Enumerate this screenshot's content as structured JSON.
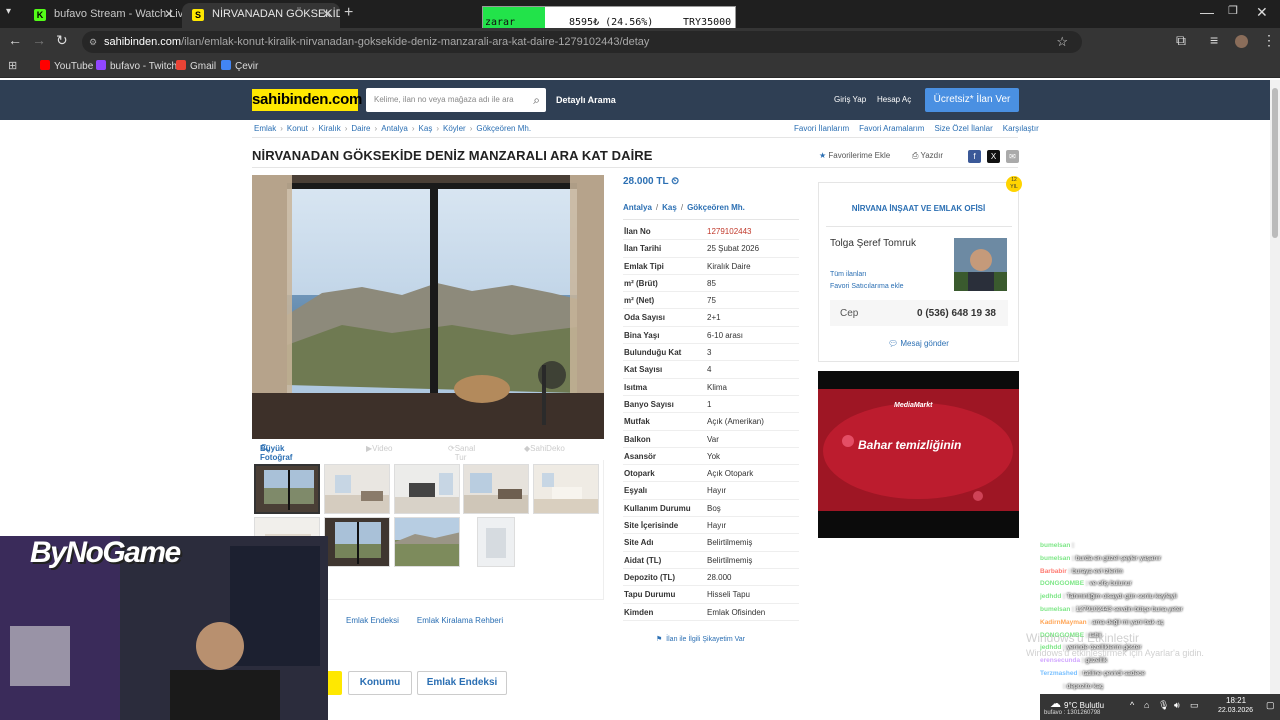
{
  "browser": {
    "tabs": [
      {
        "title": "bufavo Stream - Watch Live on",
        "active": false,
        "icon": "kick-icon",
        "color": "#53fc18"
      },
      {
        "title": "NİRVANADAN GÖKSEKİDE DEN",
        "active": true,
        "icon": "sahibinden-icon",
        "color": "#ffe800"
      }
    ],
    "url_domain": "sahibinden.com",
    "url_path": "/ilan/emlak-konut-kiralik-nirvanadan-goksekide-deniz-manzarali-ara-kat-daire-1279102443/detay",
    "bookmarks": [
      {
        "label": "YouTube",
        "color": "#ff0000"
      },
      {
        "label": "bufavo - Twitch",
        "color": "#9146ff"
      },
      {
        "label": "Gmail",
        "color": "#ea4335"
      },
      {
        "label": "Çevir",
        "color": "#4285f4"
      }
    ]
  },
  "overlay": {
    "label": "zarar",
    "value": "8595₺ (24.56%)",
    "total": "TRY35000",
    "accent": "#22e34a"
  },
  "site": {
    "logo": "sahibinden.com",
    "search_placeholder": "Kelime, ilan no veya mağaza adı ile ara",
    "detailed_search": "Detaylı Arama",
    "login": "Giriş Yap",
    "register": "Hesap Aç",
    "post_ad": "Ücretsiz* İlan Ver",
    "brand_color": "#ffe800",
    "header_color": "#2f3f54"
  },
  "breadcrumbs": [
    "Emlak",
    "Konut",
    "Kiralık",
    "Daire",
    "Antalya",
    "Kaş",
    "Köyler",
    "Gökçeören Mh."
  ],
  "right_links": [
    "Favori İlanlarım",
    "Favori Aramalarım",
    "Size Özel İlanlar",
    "Karşılaştır"
  ],
  "listing": {
    "title": "NİRVANADAN GÖKSEKİDE DENİZ MANZARALI ARA KAT DAİRE",
    "add_favorite": "Favorilerime Ekle",
    "print": "Yazdır",
    "photo_tabs": [
      "Büyük Fotoğraf",
      "Video",
      "Sanal Tur",
      "SahiDeko"
    ],
    "price": "28.000 TL",
    "location": [
      "Antalya",
      "Kaş",
      "Gökçeören Mh."
    ],
    "attributes": [
      {
        "key": "İlan No",
        "value": "1279102443"
      },
      {
        "key": "İlan Tarihi",
        "value": "25 Şubat 2026"
      },
      {
        "key": "Emlak Tipi",
        "value": "Kiralık Daire"
      },
      {
        "key": "m² (Brüt)",
        "value": "85"
      },
      {
        "key": "m² (Net)",
        "value": "75"
      },
      {
        "key": "Oda Sayısı",
        "value": "2+1"
      },
      {
        "key": "Bina Yaşı",
        "value": "6-10 arası"
      },
      {
        "key": "Bulunduğu Kat",
        "value": "3"
      },
      {
        "key": "Kat Sayısı",
        "value": "4"
      },
      {
        "key": "Isıtma",
        "value": "Klima"
      },
      {
        "key": "Banyo Sayısı",
        "value": "1"
      },
      {
        "key": "Mutfak",
        "value": "Açık (Amerikan)"
      },
      {
        "key": "Balkon",
        "value": "Var"
      },
      {
        "key": "Asansör",
        "value": "Yok"
      },
      {
        "key": "Otopark",
        "value": "Açık Otopark"
      },
      {
        "key": "Eşyalı",
        "value": "Hayır"
      },
      {
        "key": "Kullanım Durumu",
        "value": "Boş"
      },
      {
        "key": "Site İçerisinde",
        "value": "Hayır"
      },
      {
        "key": "Site Adı",
        "value": "Belirtilmemiş"
      },
      {
        "key": "Aidat (TL)",
        "value": "Belirtilmemiş"
      },
      {
        "key": "Depozito (TL)",
        "value": "28.000"
      },
      {
        "key": "Tapu Durumu",
        "value": "Hisseli Tapu"
      },
      {
        "key": "Kimden",
        "value": "Emlak Ofisinden"
      }
    ],
    "complaint": "İlan ile İlgili Şikayetim Var"
  },
  "seller": {
    "store": "NİRVANA İNŞAAT VE EMLAK OFİSİ",
    "owner": "Tolga Şeref Tomruk",
    "all_ads": "Tüm ilanları",
    "fav_seller": "Favori Satıcılarıma ekle",
    "cell_label": "Cep",
    "cell_number": "0 (536) 648 19 38",
    "message": "Mesaj gönder",
    "badge_top": "12",
    "badge_bottom": "YIL"
  },
  "ad": {
    "brand": "MediaMarkt",
    "headline": "Bahar temizliğinin"
  },
  "bottom": {
    "links": [
      "Emlak Endeksi",
      "Emlak Kiralama Rehberi"
    ],
    "tabs": [
      "Konumu",
      "Emlak Endeksi"
    ]
  },
  "stream": {
    "overlay_brand": "ByNoGame"
  },
  "chat": [
    {
      "user": "bumelsan",
      "msg": "",
      "color": "#7ee787"
    },
    {
      "user": "bumelsan",
      "msg": "burda en güzel şeyler yaşanır",
      "color": "#7ee787"
    },
    {
      "user": "Barbabir",
      "msg": "buraya evl izlerim",
      "color": "#ff7b72"
    },
    {
      "user": "DONGGOMBE",
      "msg": "ve ofiş bulunur",
      "color": "#7ee787"
    },
    {
      "user": "jedhdd",
      "msg": "Tahminliğim olsaydı gün sonlu keyfeyli",
      "color": "#7ee787"
    },
    {
      "user": "bumelsan",
      "msg": "1279102443 sevdin bütçe buna yeter",
      "color": "#7ee787"
    },
    {
      "user": "KadirnMayman",
      "msg": "ama değil mi yani bak aç",
      "color": "#ffa657"
    },
    {
      "user": "DONGGOMBE",
      "msg": "tabii",
      "color": "#7ee787"
    },
    {
      "user": "jedhdd",
      "msg": "yerinde özelliklerini göster",
      "color": "#7ee787"
    },
    {
      "user": "erensecunda",
      "msg": "güzellik",
      "color": "#d2a8ff"
    },
    {
      "user": "Terzmashed",
      "msg": "tatiline çevirdi sadece",
      "color": "#79c0ff"
    },
    {
      "user": "jedhdd",
      "msg": "depozito kaç",
      "color": "#ffffff"
    }
  ],
  "windows": {
    "activate_title": "Windows'u Etkinleştir",
    "activate_sub": "Windows'u etkinleştirmek için Ayarlar'a gidin.",
    "weather": "9°C Bulutlu",
    "time": "18:21",
    "date": "22.03.2026",
    "stream_id": "bufavo : 1301260798"
  }
}
